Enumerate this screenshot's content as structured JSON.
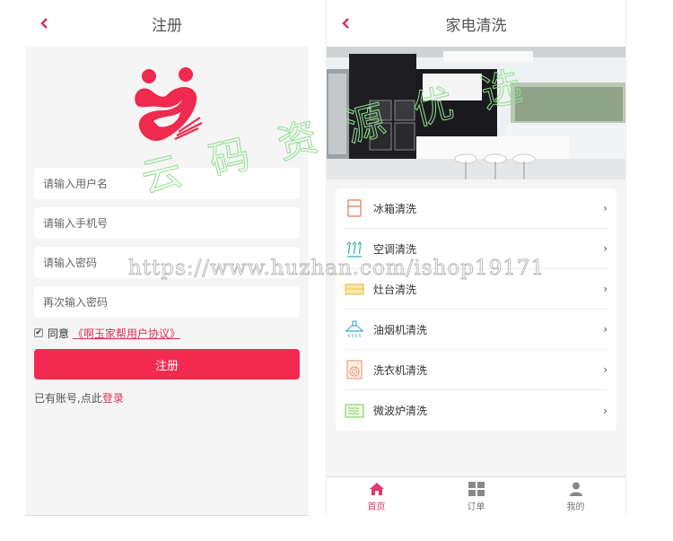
{
  "register": {
    "title": "注册",
    "back_icon": "chevron-left-icon",
    "logo": "heart-hands-logo",
    "fields": [
      {
        "name": "username",
        "placeholder": "请输入用户名",
        "value": ""
      },
      {
        "name": "phone",
        "placeholder": "请输入手机号",
        "value": ""
      },
      {
        "name": "password",
        "placeholder": "请输入密码",
        "value": ""
      },
      {
        "name": "confirm-password",
        "placeholder": "再次输入密码",
        "value": ""
      }
    ],
    "agree_checked": true,
    "agree_label": "同意",
    "agreement_link": "《啊玉家帮用户协议》",
    "submit_label": "注册",
    "have_account_text": "已有账号,点此",
    "login_link": "登录",
    "colors": {
      "accent": "#f4294f",
      "link": "#d6335c"
    }
  },
  "service": {
    "title": "家电清洗",
    "back_icon": "chevron-left-icon",
    "banner": "kitchen-photo",
    "items": [
      {
        "label": "冰箱清洗",
        "icon": "fridge-icon"
      },
      {
        "label": "空调清洗",
        "icon": "air-conditioner-icon"
      },
      {
        "label": "灶台清洗",
        "icon": "stove-icon"
      },
      {
        "label": "油烟机清洗",
        "icon": "range-hood-icon"
      },
      {
        "label": "洗衣机清洗",
        "icon": "washing-machine-icon"
      },
      {
        "label": "微波炉清洗",
        "icon": "microwave-icon"
      }
    ],
    "chevron": "›",
    "tabs": [
      {
        "label": "首页",
        "icon": "home-icon",
        "active": true
      },
      {
        "label": "订单",
        "icon": "grid-icon",
        "active": false
      },
      {
        "label": "我的",
        "icon": "user-icon",
        "active": false
      }
    ]
  },
  "watermark": {
    "url": "https://www.huzhan.com/ishop19171",
    "text": "云码资源优选"
  }
}
